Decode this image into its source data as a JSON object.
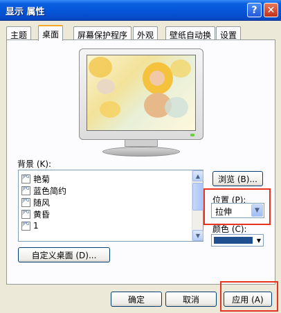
{
  "window": {
    "title": "显示 属性"
  },
  "titlebar": {
    "help_label": "?",
    "close_label": "✕"
  },
  "tabs": [
    {
      "label": "主题",
      "active": false
    },
    {
      "label": "桌面",
      "active": true
    },
    {
      "label": "屏幕保护程序",
      "active": false
    },
    {
      "label": "外观",
      "active": false
    },
    {
      "label": "壁纸自动换",
      "active": false
    },
    {
      "label": "设置",
      "active": false
    }
  ],
  "background": {
    "label": "背景 (K):",
    "items": [
      "艳菊",
      "蓝色简约",
      "随风",
      "黄昏",
      "1"
    ],
    "icon": "jpg-file-icon",
    "icon_text": "JPG"
  },
  "browse_button": "浏览 (B)...",
  "position": {
    "label": "位置 (P):",
    "selected": "拉伸"
  },
  "color": {
    "label": "颜色 (C):",
    "swatch": "#1f4f8e"
  },
  "customize_button": "自定义桌面 (D)...",
  "footer": {
    "ok": "确定",
    "cancel": "取消",
    "apply": "应用 (A)"
  },
  "colors": {
    "highlight_box": "#e8321f",
    "title_blue": "#0553d6"
  }
}
